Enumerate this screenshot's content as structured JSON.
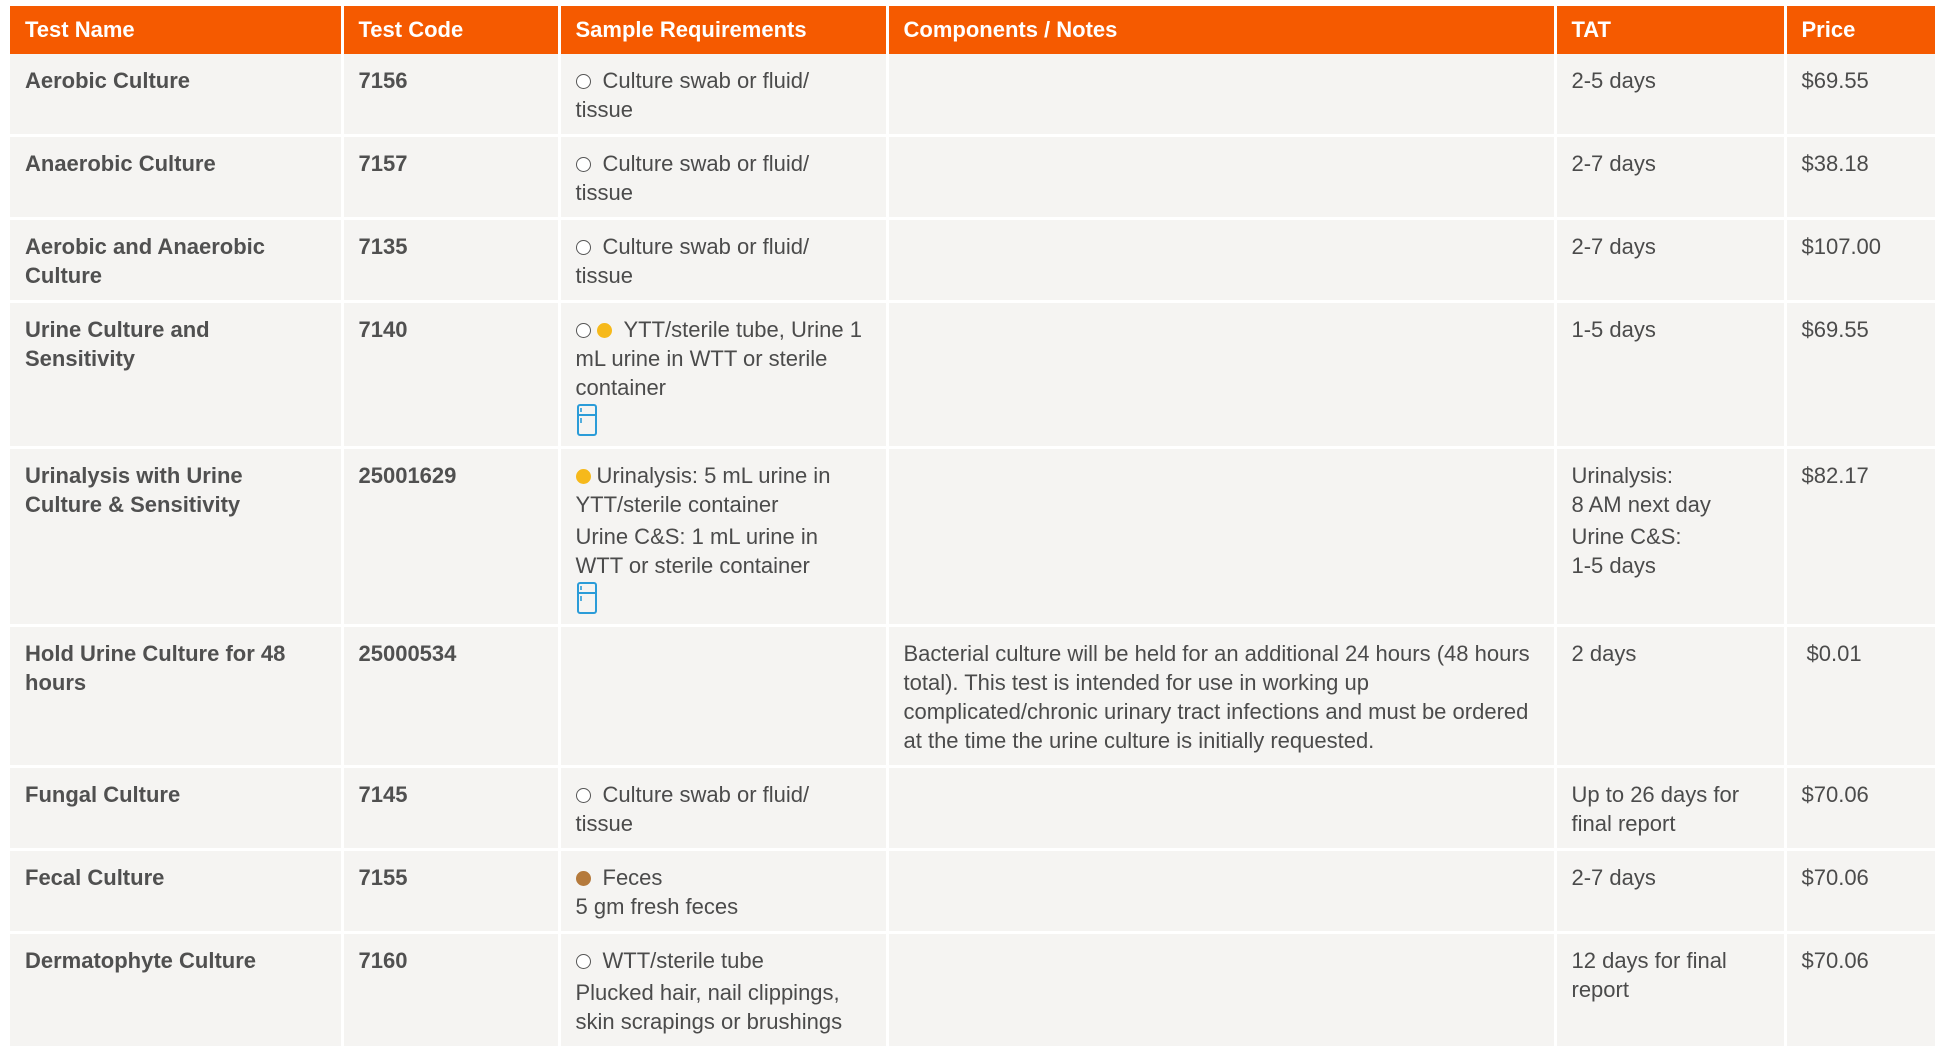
{
  "header": {
    "test_name": "Test Name",
    "test_code": "Test Code",
    "sample_requirements": "Sample Requirements",
    "components_notes": "Components / Notes",
    "tat": "TAT",
    "price": "Price"
  },
  "colors": {
    "header_bg": "#f55a00",
    "row_bg": "#f5f4f2",
    "dot_yellow": "#f6b91b",
    "dot_brown": "#b57a3c",
    "fridge_icon": "#2b9cd8"
  },
  "rows": [
    {
      "name": "Aerobic Culture",
      "code": "7156",
      "sample": [
        "Culture swab or fluid/ tissue"
      ],
      "notes": "",
      "tat": [
        "2-5 days"
      ],
      "price": "$69.55"
    },
    {
      "name": "Anaerobic Culture",
      "code": "7157",
      "sample": [
        "Culture swab or fluid/ tissue"
      ],
      "notes": "",
      "tat": [
        "2-7 days"
      ],
      "price": "$38.18"
    },
    {
      "name": "Aerobic and Anaerobic Culture",
      "code": "7135",
      "sample": [
        "Culture swab or fluid/ tissue"
      ],
      "notes": "",
      "tat": [
        "2-7 days"
      ],
      "price": "$107.00"
    },
    {
      "name": "Urine Culture and Sensitivity",
      "code": "7140",
      "sample": [
        "YTT/sterile tube, Urine 1 mL urine in WTT or sterile container"
      ],
      "notes": "",
      "tat": [
        "1-5 days"
      ],
      "price": "$69.55"
    },
    {
      "name": "Urinalysis with Urine Culture & Sensitivity",
      "code": "25001629",
      "sample": [
        "Urinalysis: 5 mL urine in YTT/sterile container",
        "Urine C&S: 1 mL urine in WTT or sterile container"
      ],
      "notes": "",
      "tat": [
        "Urinalysis:",
        "8 AM next day",
        "Urine C&S:",
        "1-5 days"
      ],
      "price": "$82.17"
    },
    {
      "name": "Hold Urine Culture for 48 hours",
      "code": "25000534",
      "sample": [],
      "notes": "Bacterial culture will be held for an additional 24 hours (48 hours total). This test is intended for use in working up complicated/chronic urinary tract infections and must be ordered at the time the urine culture is initially requested.",
      "tat": [
        "2 days"
      ],
      "price": "$0.01"
    },
    {
      "name": "Fungal Culture",
      "code": "7145",
      "sample": [
        "Culture swab or fluid/ tissue"
      ],
      "notes": "",
      "tat": [
        "Up to 26 days for final report"
      ],
      "price": "$70.06"
    },
    {
      "name": "Fecal Culture",
      "code": "7155",
      "sample": [
        "Feces",
        "5 gm fresh feces"
      ],
      "notes": "",
      "tat": [
        "2-7 days"
      ],
      "price": "$70.06"
    },
    {
      "name": "Dermatophyte Culture",
      "code": "7160",
      "sample": [
        "WTT/sterile tube",
        "Plucked hair, nail clippings, skin scrapings or brushings"
      ],
      "notes": "",
      "tat": [
        "12 days for final report"
      ],
      "price": "$70.06"
    }
  ]
}
